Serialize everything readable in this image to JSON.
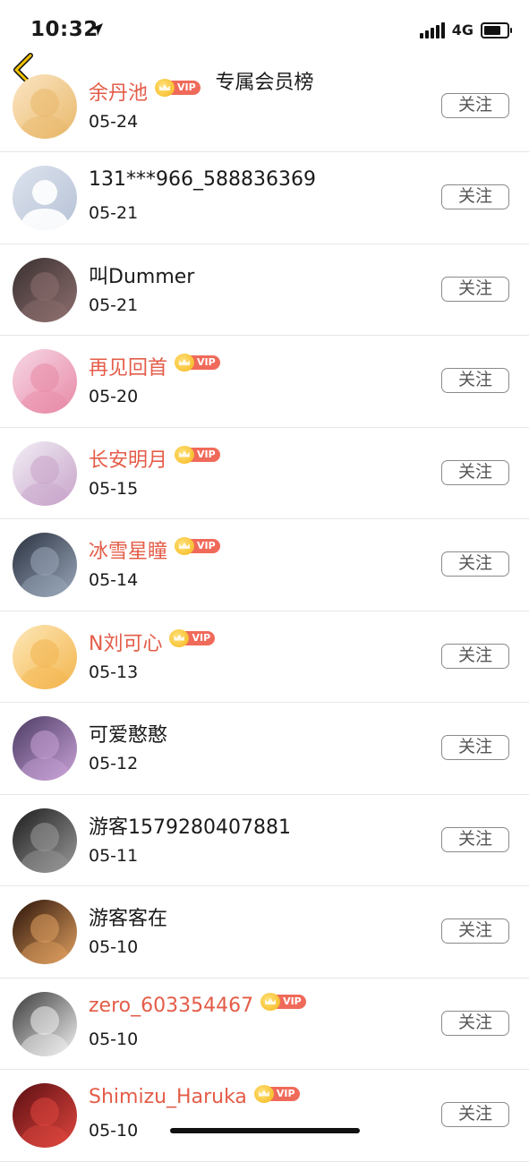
{
  "status_bar": {
    "time": "10:32",
    "network": "4G"
  },
  "nav": {
    "title": "专属会员榜",
    "back_icon": "chevron-left-icon",
    "accent_color": "#e8b800"
  },
  "vip_badge_text": "VIP",
  "follow_label": "关注",
  "members": [
    {
      "name": "余丹池",
      "date": "05-24",
      "vip": true,
      "avatar_colors": [
        "#fbe6c4",
        "#e9b86a"
      ]
    },
    {
      "name": "131***966_588836369",
      "date": "05-21",
      "vip": false,
      "avatar_colors": [
        "#dde3ee",
        "#b6c2d6"
      ]
    },
    {
      "name": "叫Dummer",
      "date": "05-21",
      "vip": false,
      "avatar_colors": [
        "#3a3030",
        "#8e6f6f"
      ]
    },
    {
      "name": "再见回首",
      "date": "05-20",
      "vip": true,
      "avatar_colors": [
        "#f6d7e6",
        "#e88aa6"
      ]
    },
    {
      "name": "长安明月",
      "date": "05-15",
      "vip": true,
      "avatar_colors": [
        "#f1eef5",
        "#c8a3c9"
      ]
    },
    {
      "name": "冰雪星瞳",
      "date": "05-14",
      "vip": true,
      "avatar_colors": [
        "#2a3140",
        "#9aa8ba"
      ]
    },
    {
      "name": "N刘可心",
      "date": "05-13",
      "vip": true,
      "avatar_colors": [
        "#fde8b8",
        "#f3b54e"
      ]
    },
    {
      "name": "可爱憨憨",
      "date": "05-12",
      "vip": false,
      "avatar_colors": [
        "#4c3b64",
        "#c8a2d6"
      ]
    },
    {
      "name": "游客1579280407881",
      "date": "05-11",
      "vip": false,
      "avatar_colors": [
        "#1c1c1c",
        "#9a9a9a"
      ]
    },
    {
      "name": "游客客在",
      "date": "05-10",
      "vip": false,
      "avatar_colors": [
        "#2a1208",
        "#e0a060"
      ]
    },
    {
      "name": "zero_603354467",
      "date": "05-10",
      "vip": true,
      "avatar_colors": [
        "#3a3a3a",
        "#f2f2f2"
      ]
    },
    {
      "name": "Shimizu_Haruka",
      "date": "05-10",
      "vip": true,
      "avatar_colors": [
        "#5a0e12",
        "#e0463e"
      ]
    }
  ]
}
